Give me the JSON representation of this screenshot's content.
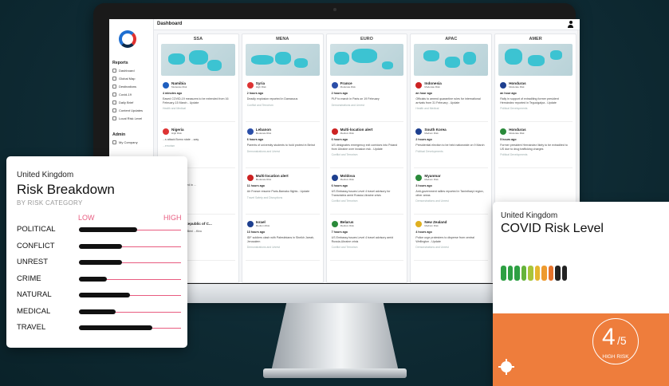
{
  "dashboard": {
    "title": "Dashboard",
    "sidebar": {
      "reports_heading": "Reports",
      "reports_items": [
        "Dashboard",
        "Global Map",
        "Destinations",
        "Covid-19",
        "Daily Brief",
        "Content Updates",
        "Local Risk Level"
      ],
      "admin_heading": "Admin",
      "admin_items": [
        "My Company"
      ]
    },
    "columns": [
      {
        "region": "SSA",
        "cards": [
          {
            "country": "Namibia",
            "risk": "Moderate Risk",
            "time": "4 minutes ago",
            "desc": "Eased COVID-19 measures to be extended from 16 February-15 March - Update",
            "cat": "Health and Medical"
          },
          {
            "country": "Nigeria",
            "risk": "High Risk",
            "time": "",
            "desc": "...s attack Borno state ...way",
            "cat": "...errorism"
          },
          {
            "country": "...bon",
            "risk": "",
            "time": "",
            "desc": "...ram attack reported in ...",
            "cat": "...errorism"
          },
          {
            "country": "...cratic Republic of C...",
            "risk": "",
            "time": "",
            "desc": "...ckers reported in Beni ...Kivu",
            "cat": "...errorism"
          }
        ]
      },
      {
        "region": "MENA",
        "cards": [
          {
            "country": "Syria",
            "risk": "High Risk",
            "time": "2 hours ago",
            "desc": "Deadly explosion reported in Damascus",
            "cat": "Conflict and Terrorism"
          },
          {
            "country": "Lebanon",
            "risk": "Moderate Risk",
            "time": "6 hours ago",
            "desc": "Parents of university students to hold protest in Beirut",
            "cat": "Demonstrations and Unrest"
          },
          {
            "country": "Multi-location alert",
            "risk": "Moderate Risk",
            "time": "11 hours ago",
            "desc": "Air France resume Paris-Bamako flights - Update",
            "cat": "Travel Safety and Disruptions"
          },
          {
            "country": "Israel",
            "risk": "Medium Risk",
            "time": "13 hours ago",
            "desc": "IDF soldiers clash with Palestinians in Sheikh Jarrah, Jerusalem",
            "cat": "Demonstrations and Unrest"
          }
        ]
      },
      {
        "region": "EURO",
        "cards": [
          {
            "country": "France",
            "risk": "Moderate Risk",
            "time": "2 hours ago",
            "desc": "PLP to march in Paris on 19 February",
            "cat": "Demonstrations and Unrest"
          },
          {
            "country": "Multi-location alert",
            "risk": "Medium Risk",
            "time": "6 hours ago",
            "desc": "US designates emergency exit corridors into Poland from Ukraine over invasion risk - Update",
            "cat": "Conflict and Terrorism"
          },
          {
            "country": "Moldova",
            "risk": "Medium Risk",
            "time": "6 hours ago",
            "desc": "US Embassy issues Level 4 travel advisory for Transnistria amid Russia-Ukraine crisis",
            "cat": "Conflict and Terrorism"
          },
          {
            "country": "Belarus",
            "risk": "Medium Risk",
            "time": "7 hours ago",
            "desc": "US Embassy issues Level 4 travel advisory amid Russia-Ukraine crisis",
            "cat": "Conflict and Terrorism"
          }
        ]
      },
      {
        "region": "APAC",
        "cards": [
          {
            "country": "Indonesia",
            "risk": "Moderate Risk",
            "time": "an hour ago",
            "desc": "Officials to amend quarantine rules for international arrivals from 31 February - Update",
            "cat": "Health and Medical"
          },
          {
            "country": "South Korea",
            "risk": "Medium Risk",
            "time": "2 hours ago",
            "desc": "Presidential election to be held nationwide on 9 March",
            "cat": "Political Developments"
          },
          {
            "country": "Myanmar",
            "risk": "Medium Risk",
            "time": "3 hours ago",
            "desc": "Anti-government rallies reported in Tanintharyi region, other areas",
            "cat": "Demonstrations and Unrest"
          },
          {
            "country": "New Zealand",
            "risk": "Medium Risk",
            "time": "4 hours ago",
            "desc": "Police urge protesters to disperse from central Wellington - Update",
            "cat": "Demonstrations and Unrest"
          }
        ]
      },
      {
        "region": "AMER",
        "cards": [
          {
            "country": "Honduras",
            "risk": "Moderate Risk",
            "time": "an hour ago",
            "desc": "Rally in support of extraditing former president Hernández reported in Tegucigalpa - Update",
            "cat": "Political Developments"
          },
          {
            "country": "Honduras",
            "risk": "Moderate Risk",
            "time": "5 hours ago",
            "desc": "Former president Hernández likely to be extradited to US due to drug trafficking charges",
            "cat": "Political Developments"
          }
        ]
      }
    ]
  },
  "risk_breakdown": {
    "country": "United Kingdom",
    "title": "Risk Breakdown",
    "subtitle": "BY RISK CATEGORY",
    "low_label": "LOW",
    "high_label": "HIGH",
    "categories": [
      {
        "name": "POLITICAL",
        "level": 0.57
      },
      {
        "name": "CONFLICT",
        "level": 0.42
      },
      {
        "name": "UNREST",
        "level": 0.42
      },
      {
        "name": "CRIME",
        "level": 0.27
      },
      {
        "name": "NATURAL",
        "level": 0.5
      },
      {
        "name": "MEDICAL",
        "level": 0.36
      },
      {
        "name": "TRAVEL",
        "level": 0.72
      }
    ],
    "colors": {
      "accent": "#e85c80",
      "bar": "#111111"
    }
  },
  "covid_risk": {
    "country": "United Kingdom",
    "title": "COVID Risk Level",
    "value": "4",
    "out_of": "/5",
    "level_label": "HIGH RISK",
    "segments_total": 10,
    "segment_colors": [
      "#2ea043",
      "#2ea043",
      "#2ea043",
      "#66b33a",
      "#a8c43a",
      "#e5b62e",
      "#ee9a2e",
      "#e5732c",
      "#222222",
      "#222222"
    ],
    "panel_color": "#ee7d3c",
    "icon": "virus-icon"
  }
}
